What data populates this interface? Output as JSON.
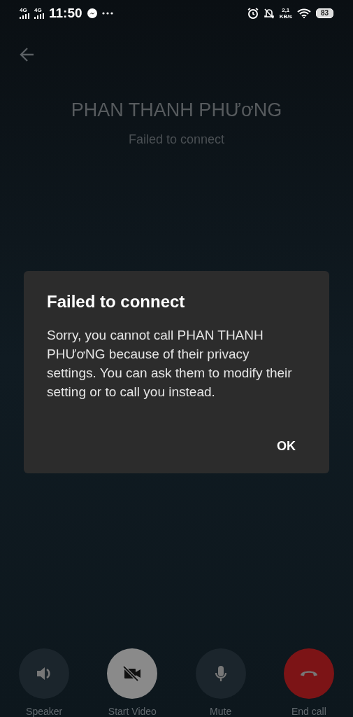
{
  "status_bar": {
    "networks": [
      "4G",
      "4G"
    ],
    "time": "11:50",
    "speed_value": "2,1",
    "speed_unit": "KB/s",
    "battery": "83"
  },
  "call": {
    "name": "PHAN THANH PHƯơNG",
    "status": "Failed to connect"
  },
  "dialog": {
    "title": "Failed to connect",
    "message": "Sorry, you cannot call PHAN THANH PHƯơNG because of their privacy settings. You can ask them to modify their setting or to call you instead.",
    "button": "OK"
  },
  "controls": [
    {
      "kind": "speaker",
      "label": "Speaker"
    },
    {
      "kind": "video",
      "label": "Start Video"
    },
    {
      "kind": "mute",
      "label": "Mute"
    },
    {
      "kind": "end",
      "label": "End call"
    }
  ]
}
